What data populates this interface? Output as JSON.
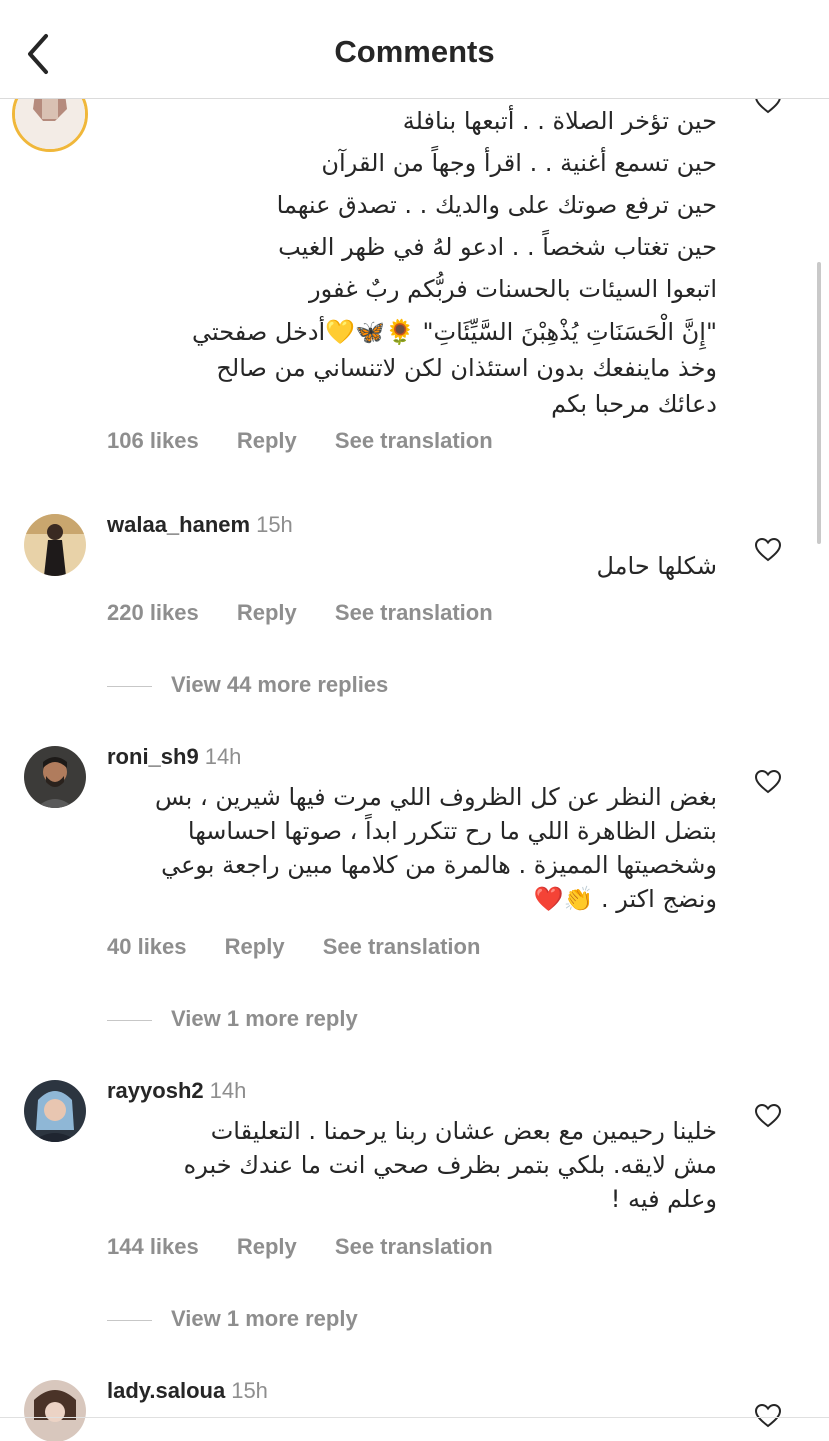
{
  "header": {
    "title": "Comments"
  },
  "labels": {
    "reply": "Reply",
    "see_translation": "See translation"
  },
  "comments": [
    {
      "username": "",
      "time": "",
      "lines": [
        "حين تؤخر الصلاة . . أتبعها بنافلة",
        "حين تسمع أغنية . . اقرأ وجهاً من القرآن",
        "حين ترفع صوتك على والديك . . تصدق عنهما",
        "حين تغتاب شخصاً . . ادعو لهُ في ظهر الغيب",
        "اتبعوا السيئات بالحسنات فربُّكم ربٌ غفور",
        "\"إِنَّ الْحَسَنَاتِ يُذْهِبْنَ السَّيِّئَاتِ\" 🌻🦋💛أدخل صفحتي",
        "وخذ ماينفعك بدون استئذان لكن لاتنساني من صالح",
        "دعائك مرحبا بكم"
      ],
      "likes": "106 likes"
    },
    {
      "username": "walaa_hanem",
      "time": "15h",
      "lines": [
        "شكلها حامل"
      ],
      "likes": "220 likes",
      "view_replies": "View 44 more replies"
    },
    {
      "username": "roni_sh9",
      "time": "14h",
      "lines": [
        "بغض النظر عن كل الظروف اللي مرت فيها شيرين ، بس",
        "بتضل الظاهرة اللي ما رح تتكرر ابداً ، صوتها احساسها",
        "وشخصيتها المميزة . هالمرة من كلامها مبين راجعة بوعي",
        "ونضج اكتر . 👏❤️"
      ],
      "likes": "40 likes",
      "view_replies": "View 1 more reply"
    },
    {
      "username": "rayyosh2",
      "time": "14h",
      "lines": [
        "خلينا رحيمين مع بعض عشان ربنا يرحمنا . التعليقات",
        "مش لايقه. بلكي بتمر بظرف صحي انت ما عندك خبره",
        "وعلم فيه !"
      ],
      "likes": "144 likes",
      "view_replies": "View 1 more reply"
    },
    {
      "username": "lady.saloua",
      "time": "15h"
    }
  ],
  "colors": {
    "text": "#262626",
    "secondary": "#8e8e8e",
    "divider": "#dbdbdb"
  }
}
